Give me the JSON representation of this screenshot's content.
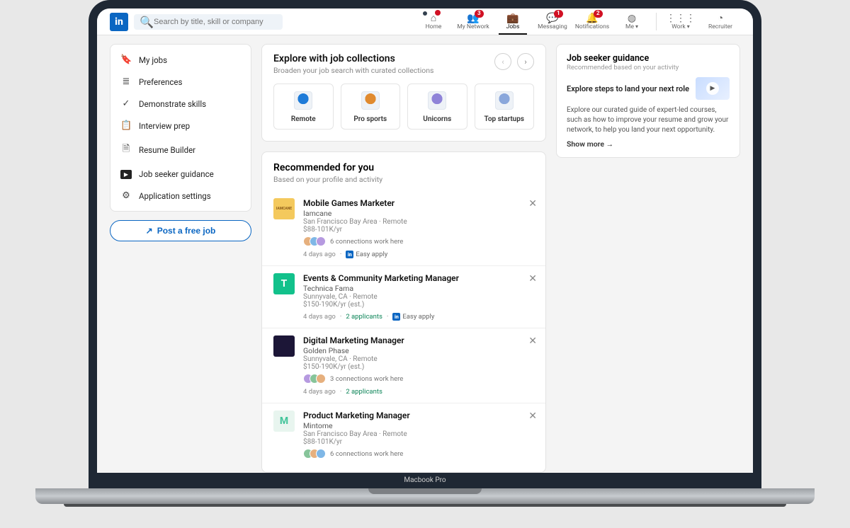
{
  "laptop": {
    "label": "Macbook Pro"
  },
  "search": {
    "placeholder": "Search by title, skill or company"
  },
  "nav": {
    "home": {
      "label": "Home",
      "badge": ""
    },
    "network": {
      "label": "My Network",
      "badge": "3"
    },
    "jobs": {
      "label": "Jobs",
      "badge": ""
    },
    "messaging": {
      "label": "Messaging",
      "badge": "1"
    },
    "notifications": {
      "label": "Notifications",
      "badge": "2"
    },
    "me": {
      "label": "Me"
    },
    "work": {
      "label": "Work"
    },
    "recruiter": {
      "label": "Recruiter"
    }
  },
  "sidebar": {
    "items": [
      {
        "label": "My jobs",
        "icon": "bookmark-icon"
      },
      {
        "label": "Preferences",
        "icon": "preferences-icon"
      },
      {
        "label": "Demonstrate skills",
        "icon": "check-icon"
      },
      {
        "label": "Interview prep",
        "icon": "clipboard-icon"
      },
      {
        "label": "Resume Builder",
        "icon": "document-icon"
      },
      {
        "label": "Job seeker guidance",
        "icon": "play-icon"
      },
      {
        "label": "Application settings",
        "icon": "gear-icon"
      }
    ],
    "post_job": "Post a free job"
  },
  "collections": {
    "title": "Explore with job collections",
    "subtitle": "Broaden your job search with curated collections",
    "items": [
      {
        "label": "Remote",
        "color": "#1e7bd8"
      },
      {
        "label": "Pro sports",
        "color": "#e08a2f"
      },
      {
        "label": "Unicorns",
        "color": "#8f83d8"
      },
      {
        "label": "Top startups",
        "color": "#8aa7db"
      }
    ]
  },
  "recommended": {
    "title": "Recommended for you",
    "subtitle": "Based on your profile and activity",
    "jobs": [
      {
        "title": "Mobile Games Marketer",
        "company": "Iamcane",
        "location": "San Francisco Bay Area · Remote",
        "salary": "$88-101K/yr",
        "connections": "6 connections work here",
        "age": "4 days ago",
        "applicants": "",
        "easy": "Easy apply",
        "logo_bg": "#f4c95d",
        "logo_text": "IAMCANE",
        "logo_color": "#8a5a1a"
      },
      {
        "title": "Events & Community Marketing Manager",
        "company": "Technica Fama",
        "location": "Sunnyvale, CA · Remote",
        "salary": "$150-190K/yr (est.)",
        "connections": "",
        "age": "4 days ago",
        "applicants": "2 applicants",
        "easy": "Easy apply",
        "logo_bg": "#12c18b",
        "logo_text": "T",
        "logo_color": "#ffffff"
      },
      {
        "title": "Digital Marketing Manager",
        "company": "Golden Phase",
        "location": "Sunnyvale, CA · Remote",
        "salary": "$150-190K/yr (est.)",
        "connections": "3 connections work here",
        "age": "4 days ago",
        "applicants": "2 applicants",
        "easy": "",
        "logo_bg": "#1c1637",
        "logo_text": "",
        "logo_color": "#c6a65c"
      },
      {
        "title": "Product Marketing Manager",
        "company": "Mintome",
        "location": "San Francisco Bay Area · Remote",
        "salary": "$88-101K/yr",
        "connections": "6 connections work here",
        "age": "",
        "applicants": "",
        "easy": "",
        "logo_bg": "#e8f5ef",
        "logo_text": "M",
        "logo_color": "#41c49a"
      }
    ]
  },
  "guidance": {
    "title": "Job seeker guidance",
    "subtitle": "Recommended based on your activity",
    "card_title": "Explore steps to land your next role",
    "body": "Explore our curated guide of expert-led courses, such as how to improve your resume and grow your network, to help you land your next opportunity.",
    "show_more": "Show more"
  },
  "icons": {
    "home": "⌂",
    "network": "👥",
    "jobs": "💼",
    "msg": "💬",
    "bell": "🔔",
    "me": "◍",
    "grid": "⋮⋮⋮",
    "recruiter": "◔",
    "bookmark": "🔖",
    "sliders": "≣",
    "check": "✓",
    "clipboard": "📋",
    "doc": "🗎",
    "play": "▶",
    "gear": "⚙",
    "external": "↗",
    "search": "🔍"
  }
}
